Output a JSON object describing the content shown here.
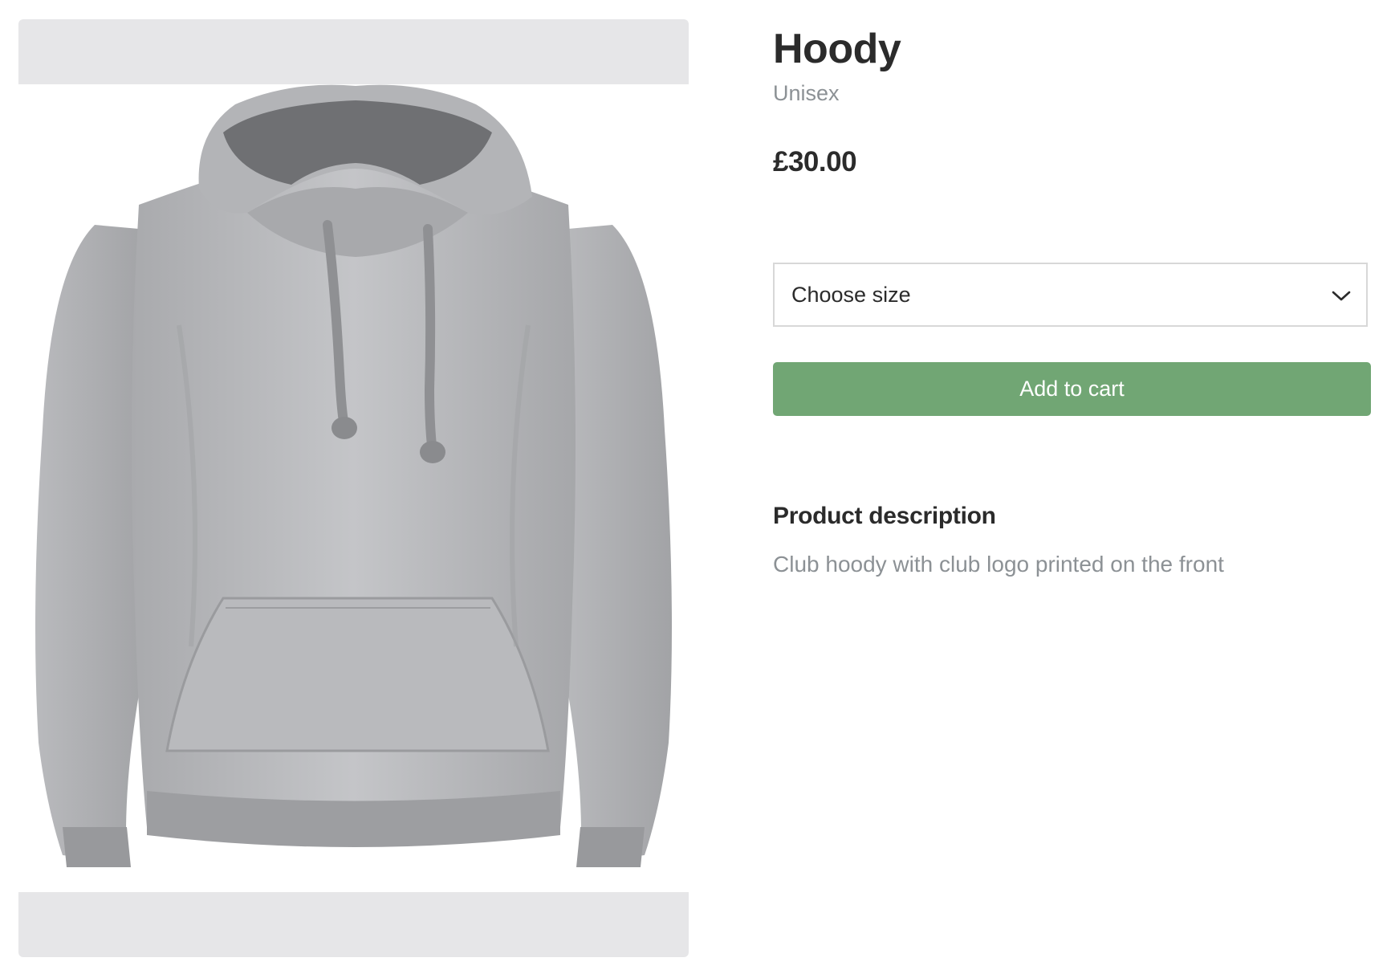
{
  "product": {
    "title": "Hoody",
    "subtitle": "Unisex",
    "price": "£30.00",
    "image_alt": "Grey hooded sweatshirt"
  },
  "size_select": {
    "selected": "Choose size",
    "icon": "chevron-down-icon"
  },
  "cart": {
    "add_label": "Add to cart",
    "button_color": "#71a674"
  },
  "description": {
    "heading": "Product description",
    "text": "Club hoody with club logo printed on the front"
  }
}
